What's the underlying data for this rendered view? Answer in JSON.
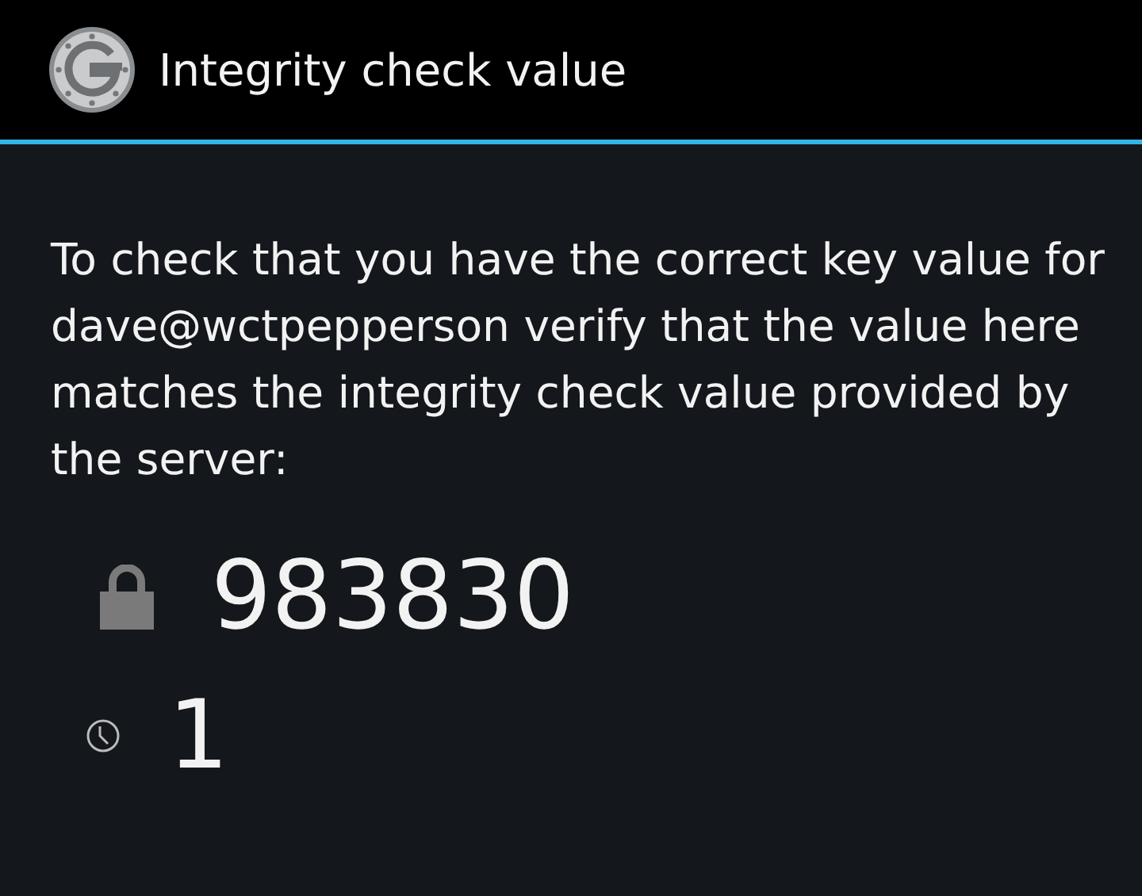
{
  "window": {
    "title": "Integrity check value"
  },
  "message": "To check that you have the correct key value for dave@wctpepperson verify that the value here matches the integrity check value provided by the server:",
  "code": "983830",
  "counter": "1"
}
